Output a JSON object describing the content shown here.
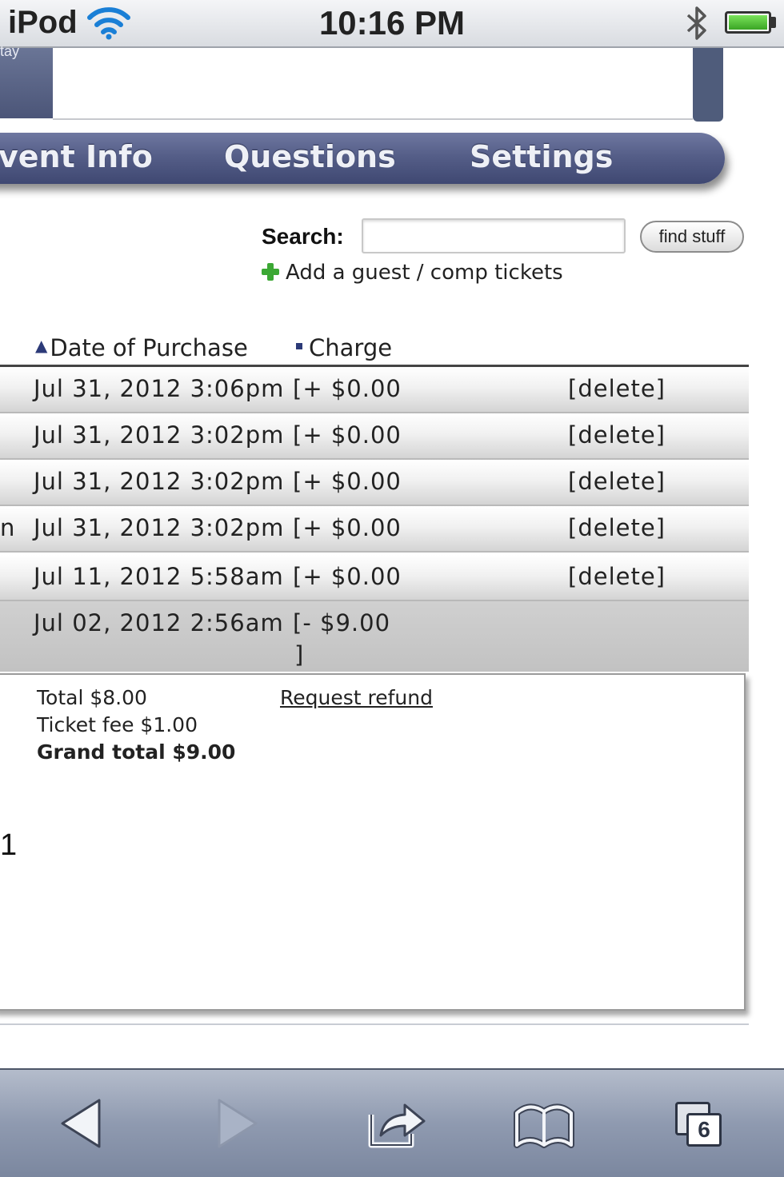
{
  "status_bar": {
    "carrier": "iPod",
    "time": "10:16 PM"
  },
  "header": {
    "left_fragment": "tay"
  },
  "nav": {
    "tabs": [
      {
        "label": "vent Info"
      },
      {
        "label": "Questions"
      },
      {
        "label": "Settings"
      }
    ]
  },
  "search": {
    "label": "Search:",
    "value": "",
    "button_label": "find stuff",
    "add_guest_label": "Add a guest / comp tickets"
  },
  "table": {
    "columns": [
      {
        "label": "Date of Purchase",
        "sort_icon": "arrow-up-icon"
      },
      {
        "label": "Charge",
        "sort_icon": "square-dot-icon"
      }
    ],
    "rows": [
      {
        "left": "",
        "date": "Jul 31, 2012 3:06pm",
        "charge": "[+ $0.00",
        "action": "[delete]"
      },
      {
        "left": "",
        "date": "Jul 31, 2012 3:02pm",
        "charge": "[+ $0.00",
        "action": "[delete]"
      },
      {
        "left": "",
        "date": "Jul 31, 2012 3:02pm",
        "charge": "[+ $0.00",
        "action": "[delete]"
      },
      {
        "left": "n",
        "date": "Jul 31, 2012 3:02pm",
        "charge": "[+ $0.00",
        "action": "[delete]"
      },
      {
        "left": "",
        "date": "Jul 11, 2012 5:58am",
        "charge": "[+ $0.00",
        "action": "[delete]"
      },
      {
        "left": "",
        "date": "Jul 02, 2012 2:56am",
        "charge": "[- $9.00",
        "charge_close": "]",
        "action": ""
      }
    ]
  },
  "details": {
    "total": "Total $8.00",
    "ticket_fee": "Ticket fee $1.00",
    "grand_total": "Grand total $9.00",
    "refund_link": "Request refund",
    "side_number": "1"
  },
  "toolbar": {
    "tab_count": "6",
    "icons": [
      "back-icon",
      "forward-icon",
      "share-icon",
      "bookmarks-icon",
      "tabs-icon"
    ]
  },
  "colors": {
    "nav_bar": "#555e88",
    "toolbar": "#8f9ab0",
    "plus_green": "#3ca834"
  }
}
